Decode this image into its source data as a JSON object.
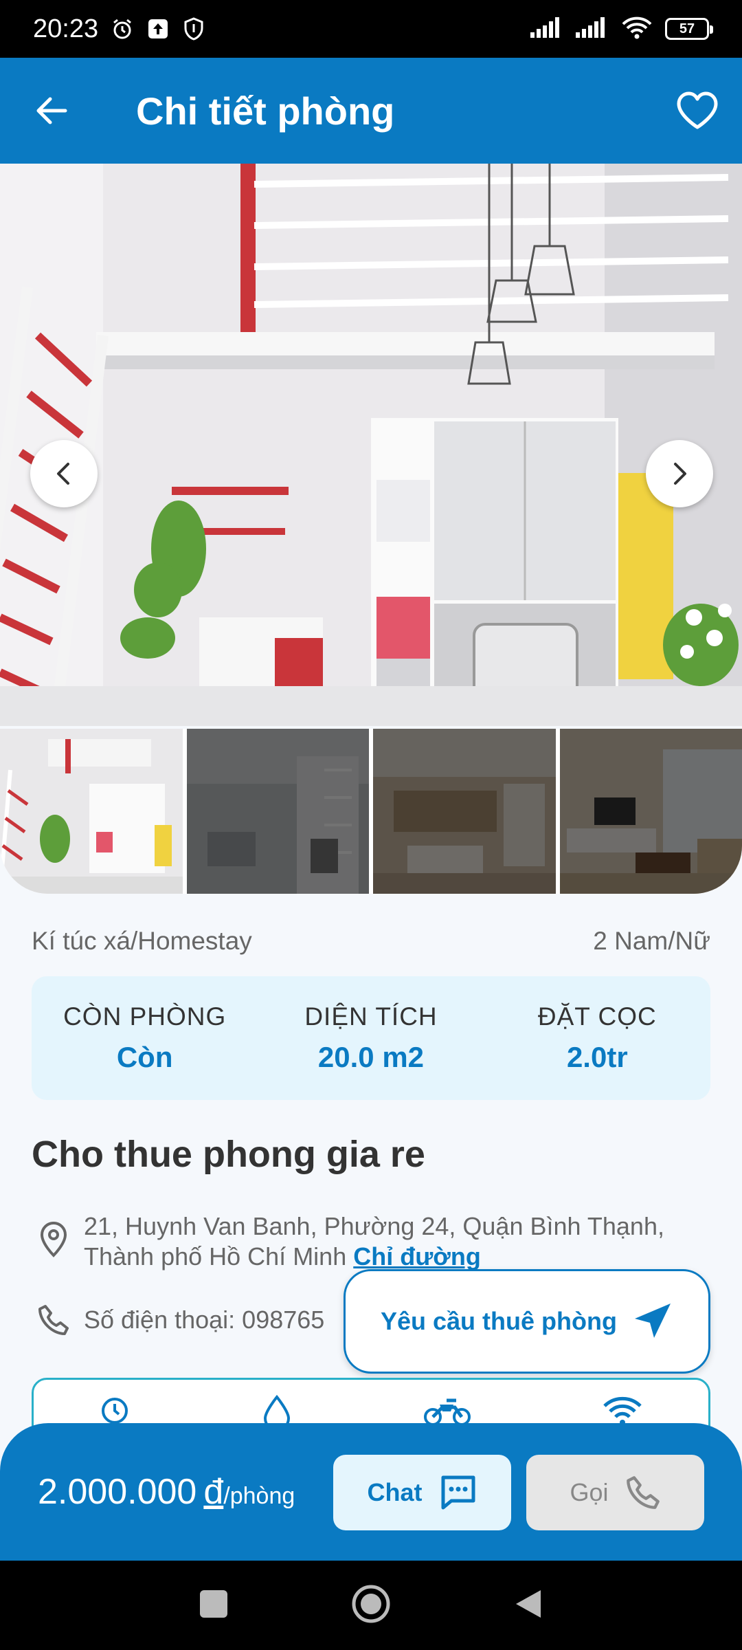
{
  "status_bar": {
    "time": "20:23",
    "battery": "57",
    "icons": [
      "alarm-icon",
      "upload-icon",
      "shield-icon",
      "signal-icon",
      "signal-icon",
      "wifi-icon",
      "battery-icon"
    ]
  },
  "app_bar": {
    "title": "Chi tiết phòng",
    "back_icon": "arrow-left-icon",
    "favorite_icon": "heart-outline-icon"
  },
  "gallery": {
    "prev_icon": "chevron-left-icon",
    "next_icon": "chevron-right-icon",
    "thumbnail_count": 4,
    "selected_index": 0
  },
  "room": {
    "type": "Kí túc xá/Homestay",
    "gender": "2 Nam/Nữ",
    "title": "Cho thue phong gia re",
    "address": "21, Huynh Van Banh, Phường 24, Quận Bình Thạnh, Thành phố Hồ Chí Minh",
    "directions_label": "Chỉ đường",
    "phone_label": "Số điện thoại: 098765"
  },
  "stats": [
    {
      "label": "CÒN PHÒNG",
      "value": "Còn"
    },
    {
      "label": "DIỆN TÍCH",
      "value": "20.0 m2"
    },
    {
      "label": "ĐẶT CỌC",
      "value": "2.0tr"
    }
  ],
  "request_button": {
    "label": "Yêu cầu thuê phòng",
    "icon": "send-icon"
  },
  "amenities": [
    "clock-icon",
    "water-drop-icon",
    "motorbike-icon",
    "wifi-icon"
  ],
  "bottom_bar": {
    "price": "2.000.000",
    "currency": "đ",
    "unit": "/phòng",
    "chat_label": "Chat",
    "call_label": "Gọi"
  },
  "colors": {
    "primary": "#0a7ac2",
    "light_blue": "#e4f5fd",
    "accent_border": "#29b0c9"
  }
}
